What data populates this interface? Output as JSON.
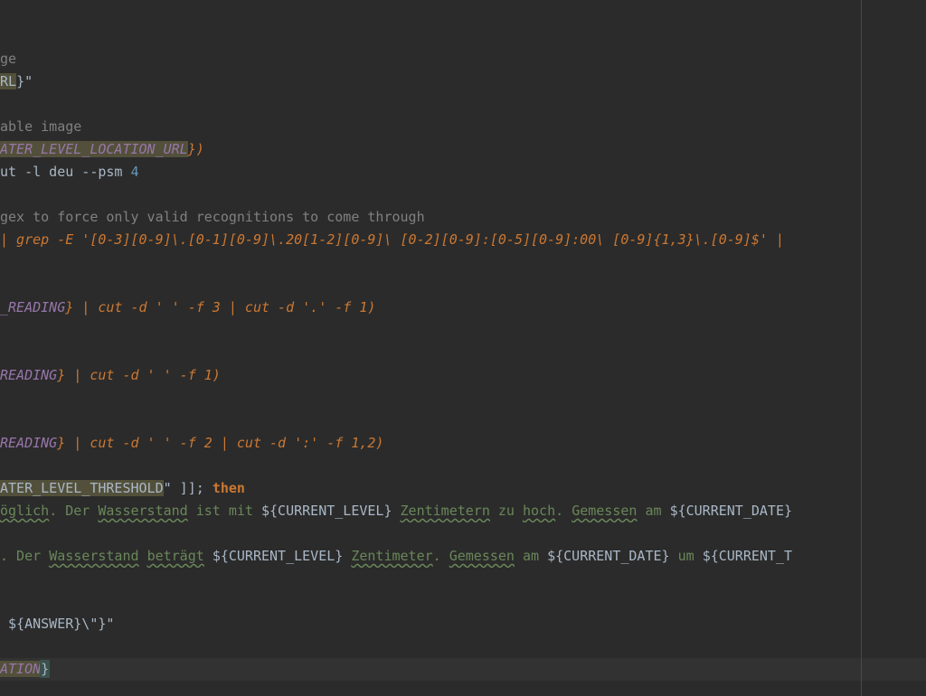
{
  "editor": {
    "lines": [
      {
        "id": "l0",
        "segments": []
      },
      {
        "id": "l1",
        "segments": []
      },
      {
        "id": "l2",
        "segments": [
          {
            "cls": "cm",
            "text": "ge"
          }
        ]
      },
      {
        "id": "l3",
        "segments": [
          {
            "cls": "str-hl",
            "text": "RL"
          },
          {
            "cls": "str",
            "text": "}\""
          }
        ]
      },
      {
        "id": "l4",
        "segments": []
      },
      {
        "id": "l5",
        "segments": [
          {
            "cls": "cm",
            "text": "able image"
          }
        ]
      },
      {
        "id": "l6",
        "segments": [
          {
            "cls": "var-hl",
            "text": "ATER_LEVEL_LOCATION_URL"
          },
          {
            "cls": "it",
            "text": "})"
          }
        ]
      },
      {
        "id": "l7",
        "segments": [
          {
            "cls": "pl",
            "text": "ut -l deu --psm "
          },
          {
            "cls": "num",
            "text": "4"
          }
        ]
      },
      {
        "id": "l8",
        "segments": []
      },
      {
        "id": "l9",
        "segments": [
          {
            "cls": "cm",
            "text": "gex to force only valid recognitions to come through"
          }
        ]
      },
      {
        "id": "l10",
        "segments": [
          {
            "cls": "it",
            "text": "| grep -E '[0-3][0-9]\\.[0-1][0-9]\\.20[1-2][0-9]\\ [0-2][0-9]:[0-5][0-9]:00\\ [0-9]{1,3}\\.[0-9]$' |"
          }
        ]
      },
      {
        "id": "l11",
        "segments": []
      },
      {
        "id": "l12",
        "segments": []
      },
      {
        "id": "l13",
        "segments": [
          {
            "cls": "var",
            "text": "_READING"
          },
          {
            "cls": "it",
            "text": "} | cut -d ' ' -f 3 | cut -d '.' -f 1)"
          }
        ]
      },
      {
        "id": "l14",
        "segments": []
      },
      {
        "id": "l15",
        "segments": []
      },
      {
        "id": "l16",
        "segments": [
          {
            "cls": "var",
            "text": "READING"
          },
          {
            "cls": "it",
            "text": "} | cut -d ' ' -f 1)"
          }
        ]
      },
      {
        "id": "l17",
        "segments": []
      },
      {
        "id": "l18",
        "segments": []
      },
      {
        "id": "l19",
        "segments": [
          {
            "cls": "var",
            "text": "READING"
          },
          {
            "cls": "it",
            "text": "} | cut -d ' ' -f 2 | cut -d ':' -f 1,2)"
          }
        ]
      },
      {
        "id": "l20",
        "segments": []
      },
      {
        "id": "l21",
        "segments": [
          {
            "cls": "str-hl",
            "text": "ATER_LEVEL_THRESHOLD"
          },
          {
            "cls": "str",
            "text": "\" ]]; "
          },
          {
            "cls": "kw",
            "text": "then"
          }
        ]
      },
      {
        "id": "l22",
        "segments": [
          {
            "cls": "typo",
            "text": "öglich"
          },
          {
            "cls": "gs",
            "text": ". Der "
          },
          {
            "cls": "typo",
            "text": "Wasserstand"
          },
          {
            "cls": "gs",
            "text": " ist mit "
          },
          {
            "cls": "pl",
            "text": "${CURRENT_LEVEL}"
          },
          {
            "cls": "gs",
            "text": " "
          },
          {
            "cls": "typo",
            "text": "Zentimetern"
          },
          {
            "cls": "gs",
            "text": " zu "
          },
          {
            "cls": "typo",
            "text": "hoch"
          },
          {
            "cls": "gs",
            "text": ". "
          },
          {
            "cls": "typo",
            "text": "Gemessen"
          },
          {
            "cls": "gs",
            "text": " am "
          },
          {
            "cls": "pl",
            "text": "${CURRENT_DATE}"
          }
        ]
      },
      {
        "id": "l23",
        "segments": []
      },
      {
        "id": "l24",
        "segments": [
          {
            "cls": "gs",
            "text": ". Der "
          },
          {
            "cls": "typo",
            "text": "Wasserstand"
          },
          {
            "cls": "gs",
            "text": " "
          },
          {
            "cls": "typo",
            "text": "beträgt"
          },
          {
            "cls": "gs",
            "text": " "
          },
          {
            "cls": "pl",
            "text": "${CURRENT_LEVEL}"
          },
          {
            "cls": "gs",
            "text": " "
          },
          {
            "cls": "typo",
            "text": "Zentimeter"
          },
          {
            "cls": "gs",
            "text": ". "
          },
          {
            "cls": "typo",
            "text": "Gemessen"
          },
          {
            "cls": "gs",
            "text": " am "
          },
          {
            "cls": "pl",
            "text": "${CURRENT_DATE}"
          },
          {
            "cls": "gs",
            "text": " um "
          },
          {
            "cls": "pl",
            "text": "${CURRENT_T"
          }
        ]
      },
      {
        "id": "l25",
        "segments": []
      },
      {
        "id": "l26",
        "segments": []
      },
      {
        "id": "l27",
        "segments": [
          {
            "cls": "pl",
            "text": " ${ANSWER}\\\"}\""
          }
        ]
      },
      {
        "id": "l28",
        "segments": []
      },
      {
        "id": "l29",
        "caret": true,
        "segments": [
          {
            "cls": "var-hl",
            "text": "ATION"
          },
          {
            "cls": "brace-hl",
            "text": "}"
          }
        ]
      },
      {
        "id": "l30",
        "segments": []
      }
    ]
  }
}
